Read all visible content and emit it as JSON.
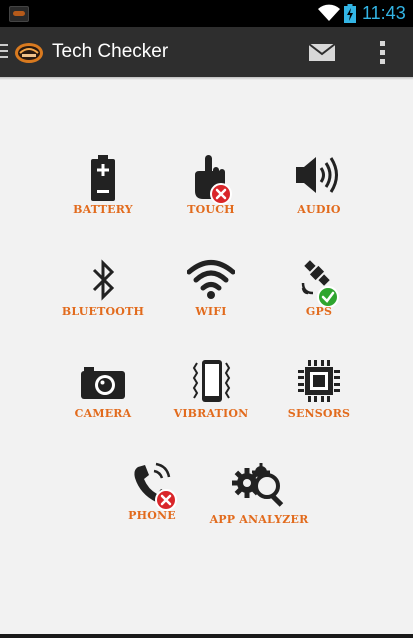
{
  "status_bar": {
    "time": "11:43",
    "icons": [
      "notification-app-icon",
      "wifi-icon",
      "battery-charging-icon"
    ],
    "accent_color": "#33b5e5"
  },
  "action_bar": {
    "title": "Tech Checker",
    "icons": [
      "nav-drawer-icon",
      "app-logo",
      "mail-icon",
      "overflow-menu-icon"
    ]
  },
  "colors": {
    "label": "#e26b1d",
    "fail_badge": "#d9262a",
    "pass_badge": "#2fa52f",
    "icon": "#222222"
  },
  "tests": [
    {
      "label": "BATTERY",
      "icon": "battery-icon",
      "status": "none"
    },
    {
      "label": "TOUCH",
      "icon": "touch-hand-icon",
      "status": "failed"
    },
    {
      "label": "AUDIO",
      "icon": "speaker-icon",
      "status": "none"
    },
    {
      "label": "BLUETOOTH",
      "icon": "bluetooth-icon",
      "status": "none"
    },
    {
      "label": "WIFI",
      "icon": "wifi-icon",
      "status": "none"
    },
    {
      "label": "GPS",
      "icon": "satellite-icon",
      "status": "passed"
    },
    {
      "label": "CAMERA",
      "icon": "camera-icon",
      "status": "none"
    },
    {
      "label": "VIBRATION",
      "icon": "vibration-phone-icon",
      "status": "none"
    },
    {
      "label": "SENSORS",
      "icon": "chip-icon",
      "status": "none"
    },
    {
      "label": "PHONE",
      "icon": "phone-handset-icon",
      "status": "failed"
    },
    {
      "label": "APP ANALYZER",
      "icon": "gears-magnifier-icon",
      "status": "none"
    }
  ]
}
